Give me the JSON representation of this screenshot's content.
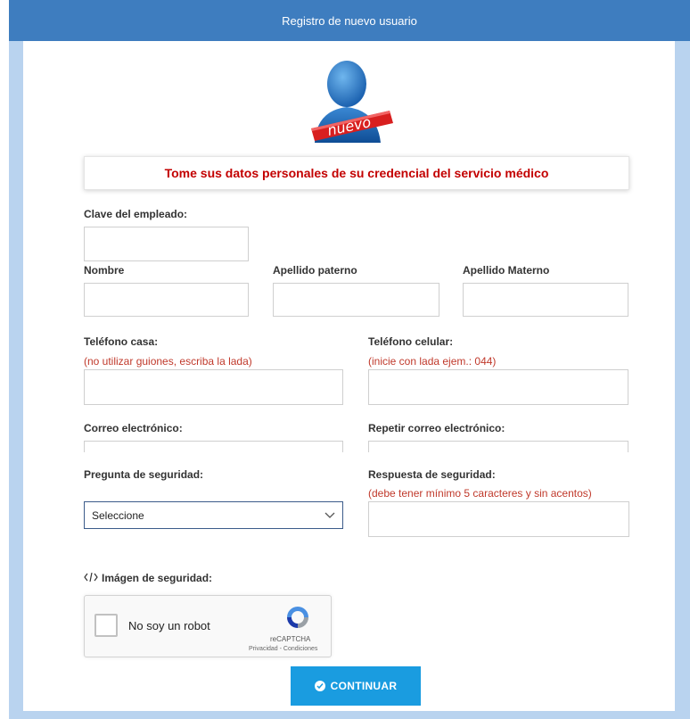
{
  "header": {
    "title": "Registro de nuevo usuario"
  },
  "avatar": {
    "badge": "nuevo"
  },
  "notice": {
    "text": "Tome sus datos personales de su credencial del servicio médico"
  },
  "form": {
    "clave_label": "Clave del empleado:",
    "nombre_label": "Nombre",
    "paterno_label": "Apellido paterno",
    "materno_label": "Apellido Materno",
    "telefono_casa_label": "Teléfono casa:",
    "telefono_casa_hint": "(no utilizar guiones, escriba la lada)",
    "telefono_celular_label": "Teléfono celular:",
    "telefono_celular_hint": "(inicie con lada ejem.: 044)",
    "correo_label": "Correo electrónico:",
    "repetir_correo_label": "Repetir correo electrónico:",
    "pregunta_label": "Pregunta de seguridad:",
    "pregunta_selected": "Seleccione",
    "respuesta_label": "Respuesta de seguridad:",
    "respuesta_hint": "(debe tener mínimo 5 caracteres y sin acentos)",
    "imagen_label": "Imágen de seguridad:"
  },
  "captcha": {
    "label": "No soy un robot",
    "brand": "reCAPTCHA",
    "links": "Privacidad - Condiciones"
  },
  "actions": {
    "continue_label": "CONTINUAR"
  },
  "colors": {
    "header_bg": "#3e7dbf",
    "frame": "#b9d3ef",
    "alert_red": "#c30000",
    "button_blue": "#1a9ce0"
  }
}
